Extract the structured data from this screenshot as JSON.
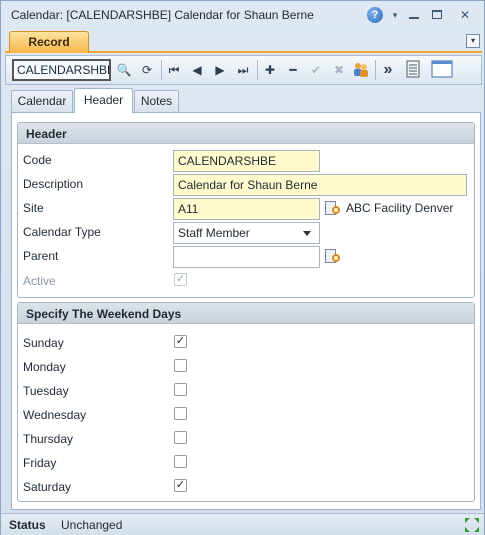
{
  "window": {
    "title": "Calendar: [CALENDARSHBE] Calendar for Shaun Berne",
    "controls": {
      "help": "?",
      "dropdown": "▾",
      "close": "✕"
    }
  },
  "tabstrip": {
    "record_tab": "Record",
    "menu_glyph": "▾"
  },
  "toolbar": {
    "record_input_value": "CALENDARSHBE",
    "icons": [
      "search-icon",
      "refresh-icon",
      "first-record-icon",
      "previous-record-icon",
      "next-record-icon",
      "last-record-icon",
      "add-icon",
      "delete-icon",
      "save-check-icon",
      "cancel-icon",
      "users-icon",
      "more-icon",
      "list-view-icon",
      "window-icon"
    ],
    "glyphs": {
      "search": "🔍",
      "refresh": "⟳",
      "first": "⏮",
      "prev": "◀",
      "next": "▶",
      "last": "⏭",
      "add": "✚",
      "delete": "━",
      "check": "✔",
      "cancel": "✖",
      "more": "»"
    }
  },
  "subtabs": {
    "calendar": "Calendar",
    "header": "Header",
    "notes": "Notes"
  },
  "header_section": {
    "title": "Header",
    "code": {
      "label": "Code",
      "value": "CALENDARSHBE"
    },
    "description": {
      "label": "Description",
      "value": "Calendar for Shaun Berne"
    },
    "site": {
      "label": "Site",
      "value": "A11",
      "lookup_text": "ABC Facility Denver"
    },
    "calendar_type": {
      "label": "Calendar Type",
      "value": "Staff Member"
    },
    "parent": {
      "label": "Parent",
      "value": ""
    },
    "active": {
      "label": "Active",
      "checked": true
    }
  },
  "weekend_section": {
    "title": "Specify The Weekend Days",
    "days": [
      {
        "label": "Sunday",
        "checked": true
      },
      {
        "label": "Monday",
        "checked": false
      },
      {
        "label": "Tuesday",
        "checked": false
      },
      {
        "label": "Wednesday",
        "checked": false
      },
      {
        "label": "Thursday",
        "checked": false
      },
      {
        "label": "Friday",
        "checked": false
      },
      {
        "label": "Saturday",
        "checked": true
      }
    ]
  },
  "statusbar": {
    "label": "Status",
    "value": "Unchanged"
  },
  "check_glyph": "✓"
}
